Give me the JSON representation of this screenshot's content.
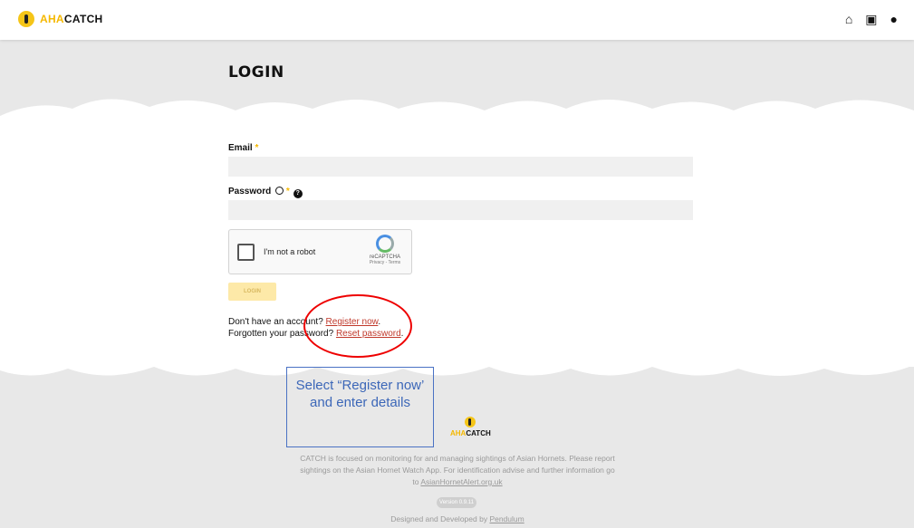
{
  "header": {
    "logo_aha": "AHA",
    "logo_catch": "CATCH",
    "icons": [
      "home-icon",
      "map-icon",
      "user-icon"
    ]
  },
  "page": {
    "title": "LOGIN"
  },
  "form": {
    "email_label": "Email",
    "password_label": "Password",
    "required_mark": "*",
    "recaptcha_text": "I'm not a robot",
    "recaptcha_brand": "reCAPTCHA",
    "recaptcha_links": "Privacy - Terms",
    "login_button": "LOGIN",
    "no_account_text": "Don't have an account? ",
    "register_link": "Register now",
    "forgot_text": "Forgotten your password? ",
    "reset_link": "Reset password",
    "period": "."
  },
  "annotation": {
    "callout_text": "Select “Register now’ and enter details"
  },
  "footer": {
    "brand_aha": "AHA",
    "brand_catch": "CATCH",
    "description": "CATCH is focused on monitoring for and managing sightings of Asian Hornets. Please report sightings on the Asian Hornet Watch App. For identification advise and further information go to ",
    "info_link": "AsianHornetAlert.org.uk",
    "version": "Version 0.9.11",
    "designed_text": "Designed and Developed by ",
    "designed_link": "Pendulum"
  },
  "colors": {
    "accent": "#f5c518",
    "link": "#c0392b",
    "annotation_red": "#e00000",
    "annotation_blue": "#3c67b8"
  }
}
